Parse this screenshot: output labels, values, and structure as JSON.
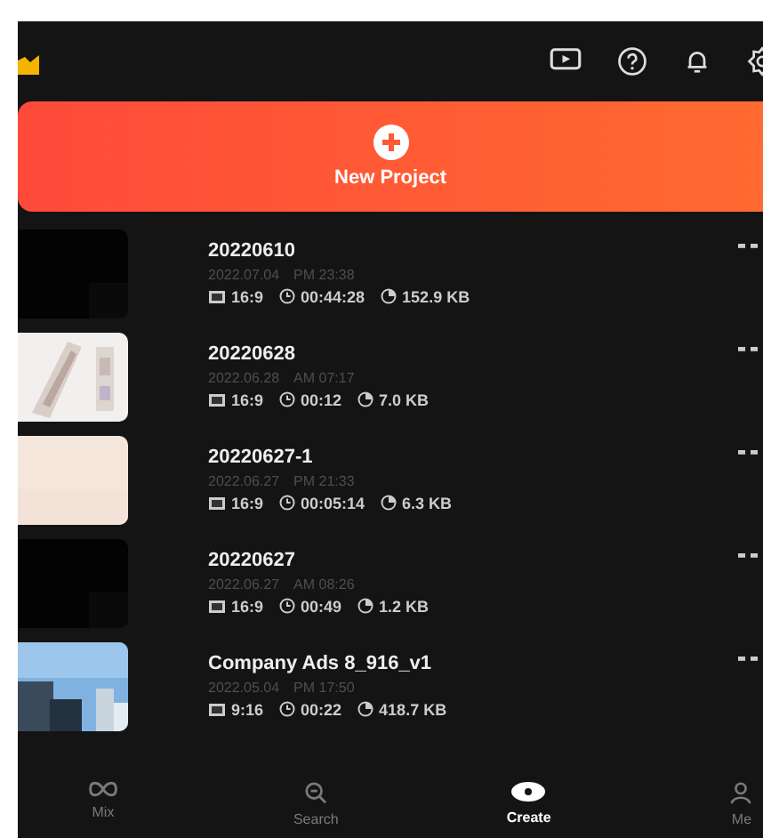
{
  "new_project": {
    "label": "New Project"
  },
  "projects": [
    {
      "title": "20220610",
      "date": "2022.07.04",
      "time": "PM 23:38",
      "ratio": "16:9",
      "duration": "00:44:28",
      "size": "152.9 KB"
    },
    {
      "title": "20220628",
      "date": "2022.06.28",
      "time": "AM 07:17",
      "ratio": "16:9",
      "duration": "00:12",
      "size": "7.0 KB"
    },
    {
      "title": "20220627-1",
      "date": "2022.06.27",
      "time": "PM 21:33",
      "ratio": "16:9",
      "duration": "00:05:14",
      "size": "6.3 KB"
    },
    {
      "title": "20220627",
      "date": "2022.06.27",
      "time": "AM 08:26",
      "ratio": "16:9",
      "duration": "00:49",
      "size": "1.2 KB"
    },
    {
      "title": "Company Ads 8_916_v1",
      "date": "2022.05.04",
      "time": "PM 17:50",
      "ratio": "9:16",
      "duration": "00:22",
      "size": "418.7 KB"
    }
  ],
  "nav": [
    {
      "label": "Mix",
      "kind": "mix",
      "selected": false
    },
    {
      "label": "Search",
      "kind": "search",
      "selected": false
    },
    {
      "label": "Create",
      "kind": "create",
      "selected": true
    },
    {
      "label": "Me",
      "kind": "me",
      "selected": false
    }
  ]
}
